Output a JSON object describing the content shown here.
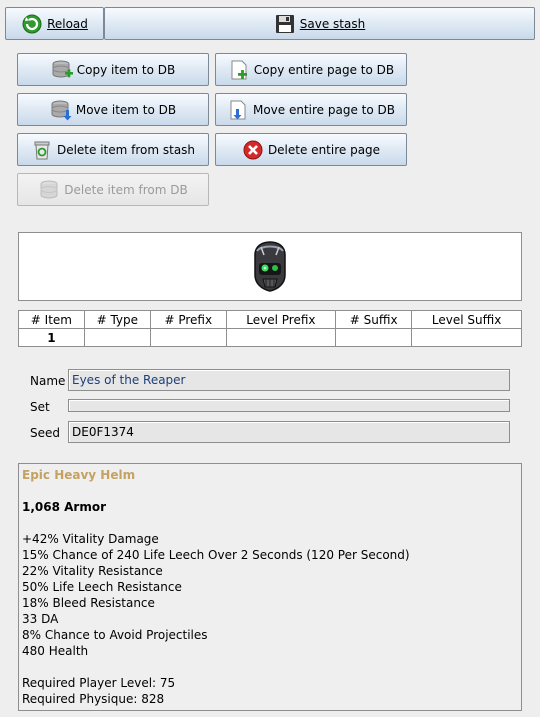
{
  "toolbar": {
    "reload_label": "Reload",
    "save_label": "Save stash"
  },
  "actions": {
    "copy_item": "Copy item to DB",
    "copy_page": "Copy entire page to DB",
    "move_item": "Move item to DB",
    "move_page": "Move entire page to DB",
    "delete_item_stash": "Delete item from stash",
    "delete_page": "Delete entire page",
    "delete_item_db": "Delete item from DB"
  },
  "table": {
    "headers": [
      "# Item",
      "# Type",
      "# Prefix",
      "Level Prefix",
      "# Suffix",
      "Level Suffix"
    ],
    "rows": [
      [
        "1",
        "",
        "",
        "",
        "",
        ""
      ]
    ]
  },
  "form": {
    "name_label": "Name",
    "name_value": "Eyes of the Reaper",
    "set_label": "Set",
    "set_value": "",
    "seed_label": "Seed",
    "seed_value": "DE0F1374"
  },
  "item": {
    "title": "Epic Heavy Helm",
    "armor": "1,068 Armor",
    "stats": [
      "+42% Vitality Damage",
      "15% Chance of 240 Life Leech Over 2 Seconds (120 Per Second)",
      "22% Vitality Resistance",
      "50% Life Leech Resistance",
      "18% Bleed Resistance",
      "33 DA",
      "8% Chance to Avoid Projectiles",
      "480 Health"
    ],
    "req_level": "Required Player Level: 75",
    "req_physique": "Required Physique: 828"
  },
  "colors": {
    "item_title": "#c4a261",
    "name_value": "#1c3f78"
  },
  "icons": {
    "reload": "refresh-arrow-icon",
    "save": "floppy-disk-icon",
    "copy_item": "database-plus-icon",
    "copy_page": "page-plus-icon",
    "move_item": "database-arrow-icon",
    "move_page": "page-arrow-icon",
    "delete_stash": "recycle-bin-icon",
    "delete_page": "red-x-icon",
    "delete_db": "database-icon",
    "item_image": "skull-helm-icon"
  }
}
